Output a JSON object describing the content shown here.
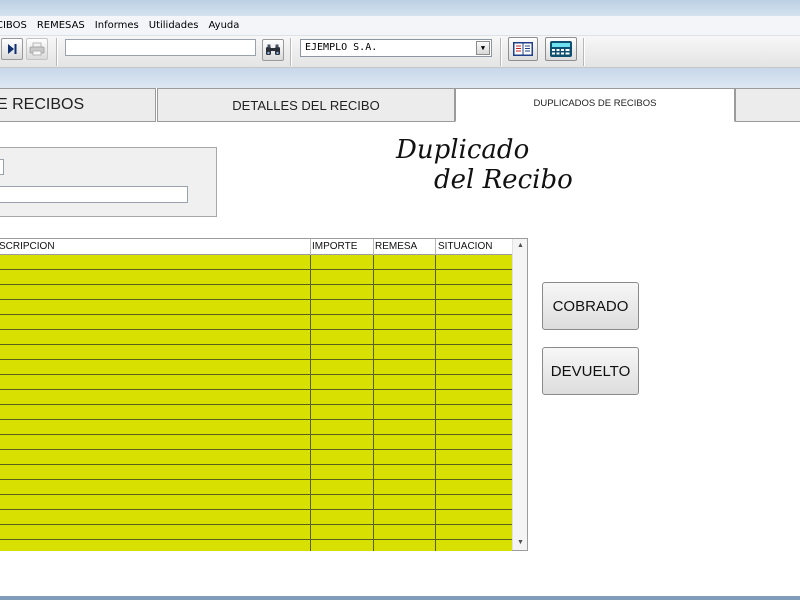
{
  "menu": {
    "items": [
      "CIBOS",
      "REMESAS",
      "Informes",
      "Utilidades",
      "Ayuda"
    ]
  },
  "toolbar": {
    "search_value": "",
    "company_selected": "EJEMPLO S.A.",
    "icons": [
      "last-record-icon",
      "print-icon",
      "binoculars-icon",
      "book-icon",
      "calculator-icon"
    ]
  },
  "tabs": [
    {
      "label": "E RECIBOS"
    },
    {
      "label": "DETALLES DEL RECIBO"
    },
    {
      "label": "DUPLICADOS DE RECIBOS"
    },
    {
      "label": ""
    }
  ],
  "header": {
    "title_line1": "Duplicado",
    "title_line2": "del Recibo"
  },
  "grid": {
    "columns": [
      "SCRIPCION",
      "IMPORTE",
      "REMESA",
      "SITUACION"
    ],
    "row_color": "#d7e000"
  },
  "actions": {
    "cobrado_label": "COBRADO",
    "devuelto_label": "DEVUELTO"
  }
}
